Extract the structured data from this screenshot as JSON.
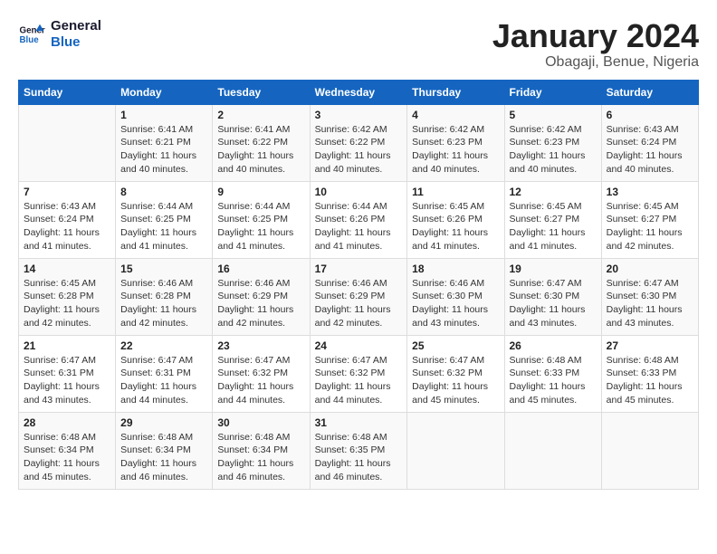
{
  "header": {
    "logo_line1": "General",
    "logo_line2": "Blue",
    "month": "January 2024",
    "location": "Obagaji, Benue, Nigeria"
  },
  "days_of_week": [
    "Sunday",
    "Monday",
    "Tuesday",
    "Wednesday",
    "Thursday",
    "Friday",
    "Saturday"
  ],
  "weeks": [
    [
      {
        "day": "",
        "info": ""
      },
      {
        "day": "1",
        "info": "Sunrise: 6:41 AM\nSunset: 6:21 PM\nDaylight: 11 hours\nand 40 minutes."
      },
      {
        "day": "2",
        "info": "Sunrise: 6:41 AM\nSunset: 6:22 PM\nDaylight: 11 hours\nand 40 minutes."
      },
      {
        "day": "3",
        "info": "Sunrise: 6:42 AM\nSunset: 6:22 PM\nDaylight: 11 hours\nand 40 minutes."
      },
      {
        "day": "4",
        "info": "Sunrise: 6:42 AM\nSunset: 6:23 PM\nDaylight: 11 hours\nand 40 minutes."
      },
      {
        "day": "5",
        "info": "Sunrise: 6:42 AM\nSunset: 6:23 PM\nDaylight: 11 hours\nand 40 minutes."
      },
      {
        "day": "6",
        "info": "Sunrise: 6:43 AM\nSunset: 6:24 PM\nDaylight: 11 hours\nand 40 minutes."
      }
    ],
    [
      {
        "day": "7",
        "info": "Sunrise: 6:43 AM\nSunset: 6:24 PM\nDaylight: 11 hours\nand 41 minutes."
      },
      {
        "day": "8",
        "info": "Sunrise: 6:44 AM\nSunset: 6:25 PM\nDaylight: 11 hours\nand 41 minutes."
      },
      {
        "day": "9",
        "info": "Sunrise: 6:44 AM\nSunset: 6:25 PM\nDaylight: 11 hours\nand 41 minutes."
      },
      {
        "day": "10",
        "info": "Sunrise: 6:44 AM\nSunset: 6:26 PM\nDaylight: 11 hours\nand 41 minutes."
      },
      {
        "day": "11",
        "info": "Sunrise: 6:45 AM\nSunset: 6:26 PM\nDaylight: 11 hours\nand 41 minutes."
      },
      {
        "day": "12",
        "info": "Sunrise: 6:45 AM\nSunset: 6:27 PM\nDaylight: 11 hours\nand 41 minutes."
      },
      {
        "day": "13",
        "info": "Sunrise: 6:45 AM\nSunset: 6:27 PM\nDaylight: 11 hours\nand 42 minutes."
      }
    ],
    [
      {
        "day": "14",
        "info": "Sunrise: 6:45 AM\nSunset: 6:28 PM\nDaylight: 11 hours\nand 42 minutes."
      },
      {
        "day": "15",
        "info": "Sunrise: 6:46 AM\nSunset: 6:28 PM\nDaylight: 11 hours\nand 42 minutes."
      },
      {
        "day": "16",
        "info": "Sunrise: 6:46 AM\nSunset: 6:29 PM\nDaylight: 11 hours\nand 42 minutes."
      },
      {
        "day": "17",
        "info": "Sunrise: 6:46 AM\nSunset: 6:29 PM\nDaylight: 11 hours\nand 42 minutes."
      },
      {
        "day": "18",
        "info": "Sunrise: 6:46 AM\nSunset: 6:30 PM\nDaylight: 11 hours\nand 43 minutes."
      },
      {
        "day": "19",
        "info": "Sunrise: 6:47 AM\nSunset: 6:30 PM\nDaylight: 11 hours\nand 43 minutes."
      },
      {
        "day": "20",
        "info": "Sunrise: 6:47 AM\nSunset: 6:30 PM\nDaylight: 11 hours\nand 43 minutes."
      }
    ],
    [
      {
        "day": "21",
        "info": "Sunrise: 6:47 AM\nSunset: 6:31 PM\nDaylight: 11 hours\nand 43 minutes."
      },
      {
        "day": "22",
        "info": "Sunrise: 6:47 AM\nSunset: 6:31 PM\nDaylight: 11 hours\nand 44 minutes."
      },
      {
        "day": "23",
        "info": "Sunrise: 6:47 AM\nSunset: 6:32 PM\nDaylight: 11 hours\nand 44 minutes."
      },
      {
        "day": "24",
        "info": "Sunrise: 6:47 AM\nSunset: 6:32 PM\nDaylight: 11 hours\nand 44 minutes."
      },
      {
        "day": "25",
        "info": "Sunrise: 6:47 AM\nSunset: 6:32 PM\nDaylight: 11 hours\nand 45 minutes."
      },
      {
        "day": "26",
        "info": "Sunrise: 6:48 AM\nSunset: 6:33 PM\nDaylight: 11 hours\nand 45 minutes."
      },
      {
        "day": "27",
        "info": "Sunrise: 6:48 AM\nSunset: 6:33 PM\nDaylight: 11 hours\nand 45 minutes."
      }
    ],
    [
      {
        "day": "28",
        "info": "Sunrise: 6:48 AM\nSunset: 6:34 PM\nDaylight: 11 hours\nand 45 minutes."
      },
      {
        "day": "29",
        "info": "Sunrise: 6:48 AM\nSunset: 6:34 PM\nDaylight: 11 hours\nand 46 minutes."
      },
      {
        "day": "30",
        "info": "Sunrise: 6:48 AM\nSunset: 6:34 PM\nDaylight: 11 hours\nand 46 minutes."
      },
      {
        "day": "31",
        "info": "Sunrise: 6:48 AM\nSunset: 6:35 PM\nDaylight: 11 hours\nand 46 minutes."
      },
      {
        "day": "",
        "info": ""
      },
      {
        "day": "",
        "info": ""
      },
      {
        "day": "",
        "info": ""
      }
    ]
  ]
}
